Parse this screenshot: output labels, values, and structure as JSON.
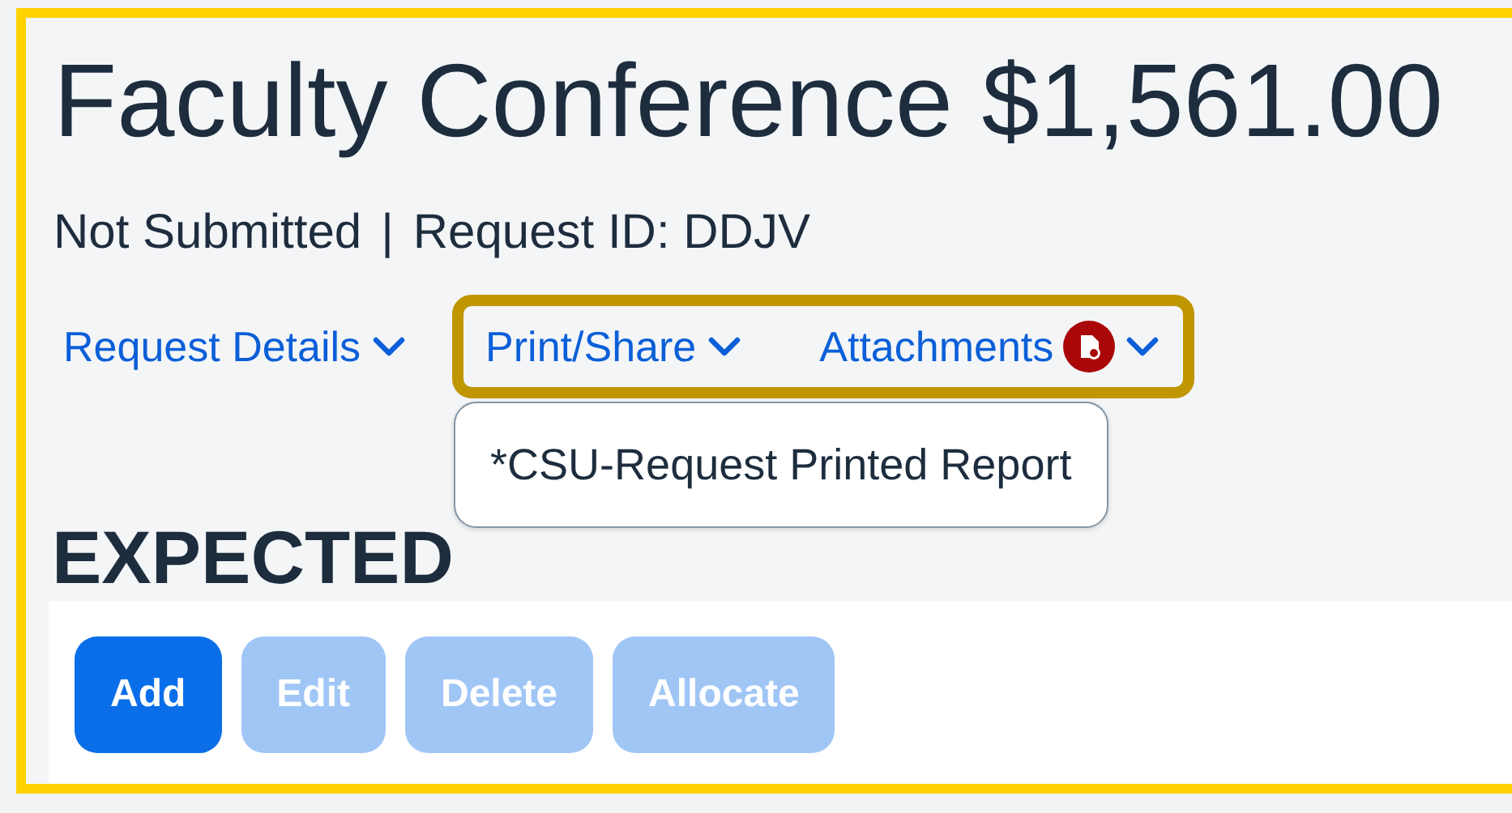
{
  "title": "Faculty Conference $1,561.00",
  "status": "Not Submitted",
  "separator": "|",
  "request_id": "Request ID: DDJV",
  "nav": [
    {
      "label": "Request Details",
      "kind": "plain",
      "highlighted": false
    },
    {
      "label": "Print/Share",
      "kind": "plain",
      "highlighted": true,
      "menu": [
        "*CSU-Request Printed Report"
      ]
    },
    {
      "label": "Attachments",
      "kind": "attachments",
      "highlighted": true
    }
  ],
  "section_heading": "EXPECTED",
  "buttons": [
    {
      "label": "Add",
      "disabled": false
    },
    {
      "label": "Edit",
      "disabled": true
    },
    {
      "label": "Delete",
      "disabled": true
    },
    {
      "label": "Allocate",
      "disabled": true
    }
  ]
}
